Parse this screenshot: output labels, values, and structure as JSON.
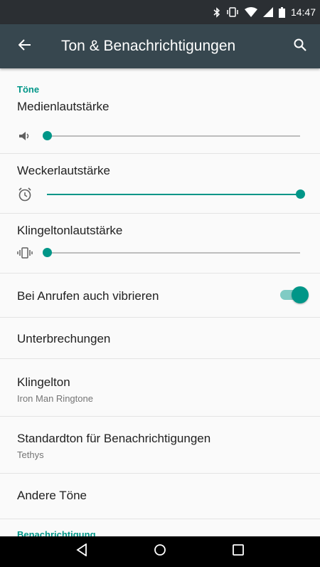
{
  "status_bar": {
    "time": "14:47",
    "icons": [
      "bluetooth-icon",
      "vibrate-icon",
      "wifi-icon",
      "signal-icon",
      "battery-icon"
    ]
  },
  "app_bar": {
    "title": "Ton & Benachrichtigungen",
    "back_icon": "arrow-back-icon",
    "search_icon": "search-icon",
    "color": "#37474f"
  },
  "sections": {
    "tones_header": "Töne",
    "notifications_header": "Benachrichtigung"
  },
  "sliders": [
    {
      "label": "Medienlautstärke",
      "icon": "speaker-icon",
      "level": 0.0
    },
    {
      "label": "Weckerlautstärke",
      "icon": "alarm-icon",
      "level": 1.0
    },
    {
      "label": "Klingeltonlautstärke",
      "icon": "vibrate-icon",
      "level": 0.0
    }
  ],
  "settings": {
    "vibrate_label": "Bei Anrufen auch vibrieren",
    "vibrate_on": true,
    "interruptions_label": "Unterbrechungen",
    "ringtone_label": "Klingelton",
    "ringtone_value": "Iron Man Ringtone",
    "notification_sound_label": "Standardton für Benachrichtigungen",
    "notification_sound_value": "Tethys",
    "other_sounds_label": "Andere Töne"
  },
  "nav_bar": {
    "icons": [
      "nav-back-icon",
      "nav-home-icon",
      "nav-recents-icon"
    ]
  },
  "accent_color": "#009688"
}
